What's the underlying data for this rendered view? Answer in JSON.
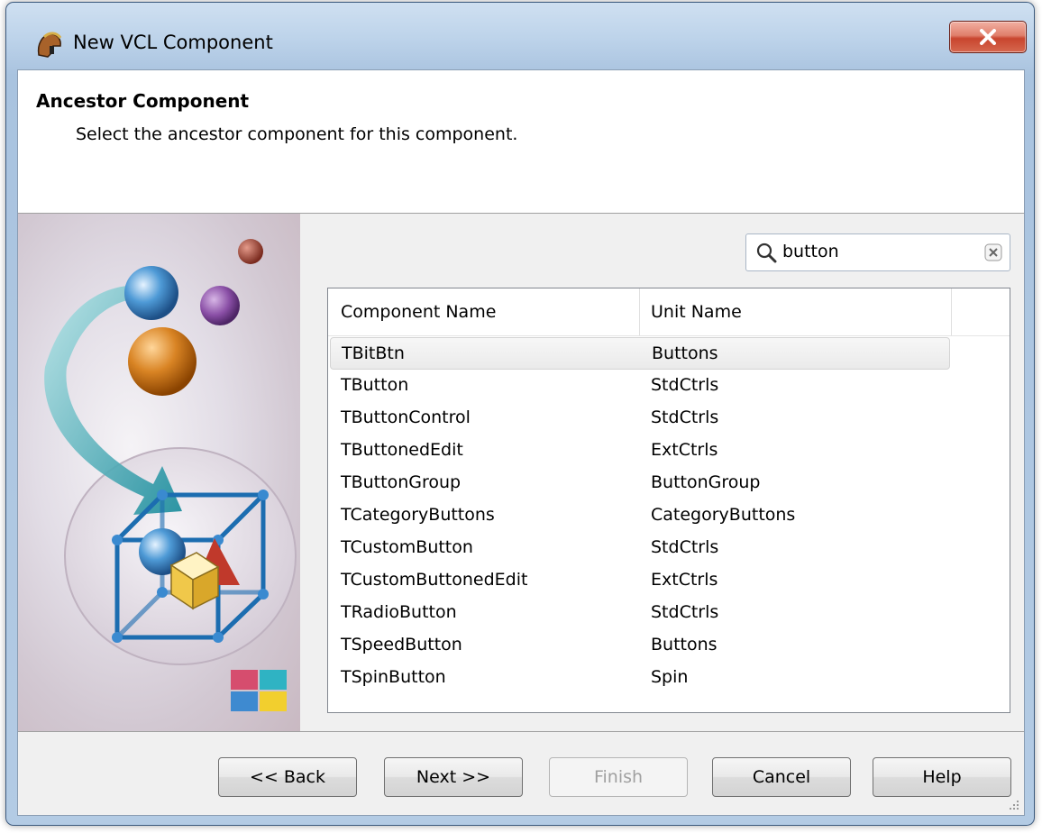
{
  "window": {
    "title": "New VCL Component"
  },
  "header": {
    "title": "Ancestor Component",
    "subtitle": "Select the ancestor component for this component."
  },
  "search": {
    "value": "button"
  },
  "list": {
    "columns": [
      "Component Name",
      "Unit Name"
    ],
    "selected_index": 0,
    "rows": [
      {
        "name": "TBitBtn",
        "unit": "Buttons"
      },
      {
        "name": "TButton",
        "unit": "StdCtrls"
      },
      {
        "name": "TButtonControl",
        "unit": "StdCtrls"
      },
      {
        "name": "TButtonedEdit",
        "unit": "ExtCtrls"
      },
      {
        "name": "TButtonGroup",
        "unit": "ButtonGroup"
      },
      {
        "name": "TCategoryButtons",
        "unit": "CategoryButtons"
      },
      {
        "name": "TCustomButton",
        "unit": "StdCtrls"
      },
      {
        "name": "TCustomButtonedEdit",
        "unit": "ExtCtrls"
      },
      {
        "name": "TRadioButton",
        "unit": "StdCtrls"
      },
      {
        "name": "TSpeedButton",
        "unit": "Buttons"
      },
      {
        "name": "TSpinButton",
        "unit": "Spin"
      }
    ]
  },
  "buttons": {
    "back": "<< Back",
    "next": "Next >>",
    "finish": "Finish",
    "cancel": "Cancel",
    "help": "Help"
  },
  "colors": {
    "selection": "#eaeaea",
    "titlebar": "#bdd3ea",
    "close": "#c8452e"
  }
}
